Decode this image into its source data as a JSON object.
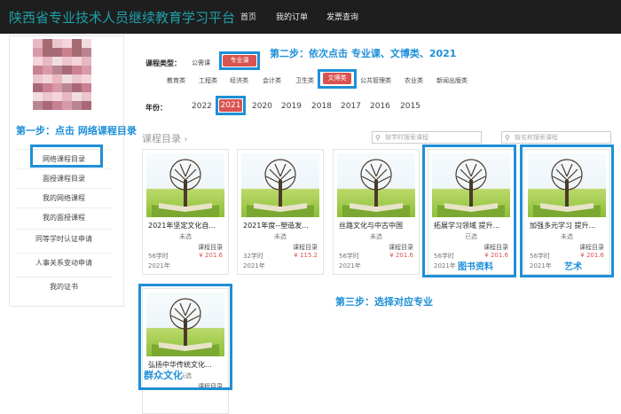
{
  "header": {
    "brand": "陕西省专业技术人员继续教育学习平台",
    "nav": [
      "首页",
      "我的订单",
      "发票查询"
    ]
  },
  "sidebar": {
    "items": [
      "网络课程目录",
      "面授课程目录",
      "我的网络课程",
      "我的面授课程",
      "同等学时认证申请",
      "人事关系变动申请",
      "我的证书"
    ]
  },
  "filters": {
    "type_label": "课程类型：",
    "types": [
      "公需课",
      "专业课"
    ],
    "categories": [
      "教育类",
      "工程类",
      "经济类",
      "会计类",
      "卫生类",
      "文博类",
      "公共管理类",
      "农业类",
      "新闻出版类"
    ],
    "year_label": "年份：",
    "years": [
      "2022",
      "2021",
      "2020",
      "2019",
      "2018",
      "2017",
      "2016",
      "2015"
    ]
  },
  "section": {
    "title": "课程目录",
    "search_course_placeholder": "按学时搜索课程",
    "search_name_placeholder": "按名称搜索课程"
  },
  "courses": [
    {
      "title": "2021年坚定文化自...",
      "status": "未选",
      "catalog": "课程目录",
      "hours": "56学时",
      "price": "¥ 201.6",
      "year": "2021年"
    },
    {
      "title": "2021年度--塑造发...",
      "status": "未选",
      "catalog": "课程目录",
      "hours": "32学时",
      "price": "¥ 115.2",
      "year": "2021年"
    },
    {
      "title": "丝路文化与中古中国",
      "status": "未选",
      "catalog": "课程目录",
      "hours": "56学时",
      "price": "¥ 201.6",
      "year": "2021年"
    },
    {
      "title": "拓展学习领域 提升...",
      "status": "已选",
      "catalog": "课程目录",
      "hours": "56学时",
      "price": "¥ 201.6",
      "year": "2021年"
    },
    {
      "title": "加强多元学习 提升...",
      "status": "未选",
      "catalog": "课程目录",
      "hours": "56学时",
      "price": "¥ 201.6",
      "year": "2021年"
    },
    {
      "title": "弘扬中华传统文化...",
      "status": "未选",
      "catalog": "课程目录",
      "hours": "",
      "price": "",
      "year": ""
    }
  ],
  "annotations": {
    "step1": "第一步：点击 网络课程目录",
    "step2": "第二步：依次点击 专业课、文博类、2021",
    "step3": "第三步：选择对应专业",
    "tag_books": "图书资料",
    "tag_art": "艺术",
    "tag_culture": "群众文化"
  },
  "colors": {
    "accent": "#1e8fd8",
    "active": "#d9534f",
    "brand": "#1fa0a8",
    "topbar": "#1e1e1e"
  }
}
